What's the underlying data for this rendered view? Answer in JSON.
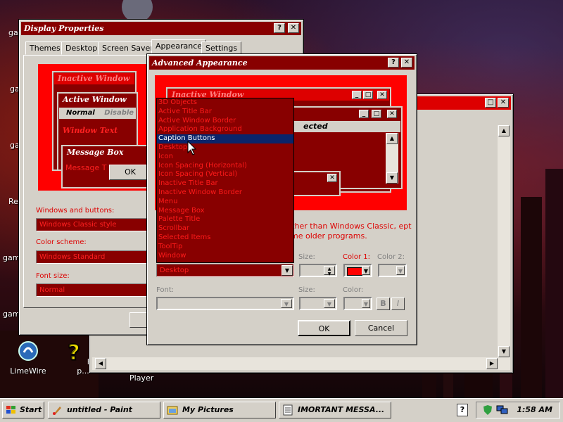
{
  "desktop": {
    "icons": [
      {
        "label": "LimeWire"
      },
      {
        "label": "help p..."
      },
      {
        "label": "Player"
      }
    ],
    "edge_labels": [
      "gam",
      "gam",
      "gam",
      "Re",
      "game",
      "game"
    ]
  },
  "display_properties": {
    "title": "Display Properties",
    "tabs": [
      "Themes",
      "Desktop",
      "Screen Saver",
      "Appearance",
      "Settings"
    ],
    "preview": {
      "inactive_title": "Inactive Window",
      "active_title": "Active Window",
      "normal": "Normal",
      "disabled": "Disable",
      "window_text": "Window Text",
      "message_box_title": "Message Box",
      "message_text": "Message T",
      "ok": "OK"
    },
    "windows_buttons_label": "Windows and buttons:",
    "windows_buttons_value": "Windows Classic style",
    "color_scheme_label": "Color scheme:",
    "color_scheme_value": "Windows Standard",
    "font_size_label": "Font size:",
    "font_size_value": "Normal"
  },
  "advanced_appearance": {
    "title": "Advanced Appearance",
    "preview": {
      "inactive_title": "Inactive Window",
      "selected_text": "ected"
    },
    "note_text": "ing other than Windows Classic, ept in some older programs.",
    "item_label": "Item:",
    "item_value": "Desktop",
    "size_label": "Size:",
    "color1_label": "Color 1:",
    "color2_label": "Color 2:",
    "font_label": "Font:",
    "font_size_label": "Size:",
    "font_color_label": "Color:",
    "bold_btn": "B",
    "italic_btn": "I",
    "ok": "OK",
    "cancel": "Cancel",
    "colors": {
      "color1": "#ff0000"
    }
  },
  "item_dropdown": {
    "options": [
      "3D Objects",
      "Active Title Bar",
      "Active Window Border",
      "Application Background",
      "Caption Buttons",
      "Desktop",
      "Icon",
      "Icon Spacing (Horizontal)",
      "Icon Spacing (Vertical)",
      "Inactive Title Bar",
      "Inactive Window Border",
      "Menu",
      "Message Box",
      "Palette Title",
      "Scrollbar",
      "Selected Items",
      "ToolTip",
      "Window"
    ],
    "selected": "Caption Buttons"
  },
  "title_buttons": {
    "help": "?",
    "close": "✕",
    "minimize": "_",
    "maximize": "□"
  },
  "taskbar": {
    "start": "Start",
    "tasks": [
      "untitled - Paint",
      "My Pictures",
      "IMORTANT MESSA..."
    ],
    "help_tray": "?",
    "clock": "1:58 AM"
  }
}
